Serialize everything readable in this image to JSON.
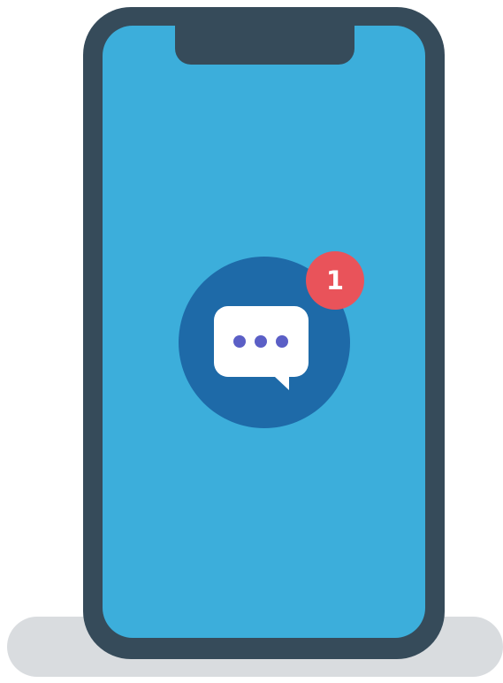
{
  "notification": {
    "badge_count": "1"
  },
  "icons": {
    "app_icon": "chat-bubble-icon",
    "typing_indicator": "ellipsis-icon"
  },
  "colors": {
    "phone_frame": "#364b5a",
    "screen": "#3caedb",
    "icon_circle": "#1e6aa8",
    "bubble": "#ffffff",
    "dots": "#5b5fc6",
    "badge": "#e9535a",
    "shadow": "#d9dcdf"
  }
}
